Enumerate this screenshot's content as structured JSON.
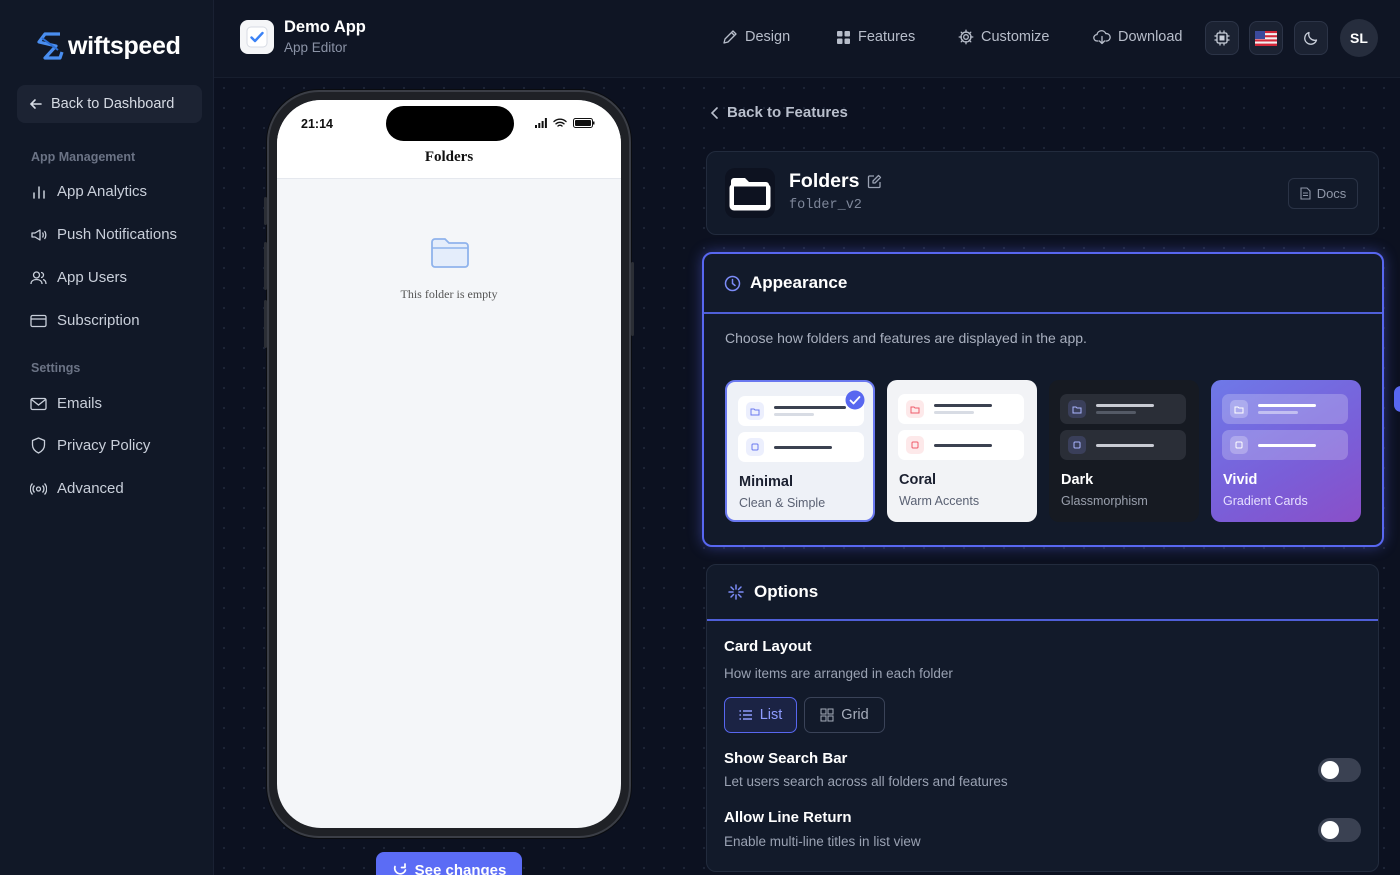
{
  "sidebar": {
    "logo_text": "wiftspeed",
    "back_label": "Back to Dashboard",
    "sections": [
      {
        "title": "App Management",
        "items": [
          {
            "label": "App Analytics",
            "icon": "bar-chart-icon"
          },
          {
            "label": "Push Notifications",
            "icon": "megaphone-icon"
          },
          {
            "label": "App Users",
            "icon": "users-icon"
          },
          {
            "label": "Subscription",
            "icon": "credit-card-icon"
          }
        ]
      },
      {
        "title": "Settings",
        "items": [
          {
            "label": "Emails",
            "icon": "mail-icon"
          },
          {
            "label": "Privacy Policy",
            "icon": "shield-icon"
          },
          {
            "label": "Advanced",
            "icon": "broadcast-icon"
          }
        ]
      }
    ]
  },
  "header": {
    "app_name": "Demo App",
    "app_subtitle": "App Editor",
    "nav": [
      {
        "label": "Design",
        "icon": "pen-icon"
      },
      {
        "label": "Features",
        "icon": "grid-icon"
      },
      {
        "label": "Customize",
        "icon": "gear-icon"
      },
      {
        "label": "Download",
        "icon": "cloud-download-icon"
      }
    ],
    "avatar_initials": "SL"
  },
  "preview": {
    "status_time": "21:14",
    "screen_title": "Folders",
    "empty_text": "This folder is empty",
    "see_changes_label": "See changes"
  },
  "main": {
    "back_label": "Back to Features",
    "feature": {
      "name": "Folders",
      "id": "folder_v2",
      "docs_label": "Docs"
    },
    "appearance": {
      "title": "Appearance",
      "description": "Choose how folders and features are displayed in the app.",
      "themes": [
        {
          "name": "Minimal",
          "subtitle": "Clean & Simple",
          "selected": true
        },
        {
          "name": "Coral",
          "subtitle": "Warm Accents",
          "selected": false
        },
        {
          "name": "Dark",
          "subtitle": "Glassmorphism",
          "selected": false
        },
        {
          "name": "Vivid",
          "subtitle": "Gradient Cards",
          "selected": false
        }
      ]
    },
    "options": {
      "title": "Options",
      "card_layout": {
        "title": "Card Layout",
        "subtitle": "How items are arranged in each folder",
        "choices": [
          "List",
          "Grid"
        ],
        "selected": "List"
      },
      "show_search": {
        "title": "Show Search Bar",
        "subtitle": "Let users search across all folders and features",
        "enabled": false
      },
      "line_return": {
        "title": "Allow Line Return",
        "subtitle": "Enable multi-line titles in list view",
        "enabled": false
      }
    }
  },
  "colors": {
    "accent": "#5867f0",
    "background": "#0d1220",
    "card": "#121a2a"
  }
}
